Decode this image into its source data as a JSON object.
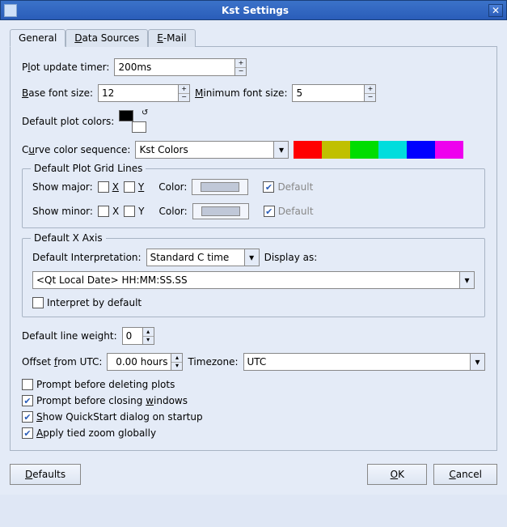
{
  "window": {
    "title": "Kst Settings"
  },
  "tabs": {
    "general": "General",
    "datasources": "Data Sources",
    "email": "E-Mail"
  },
  "plot_update": {
    "label_pre": "P",
    "label_u": "l",
    "label_post": "ot update timer:",
    "value": "200ms"
  },
  "base_font": {
    "label_u": "B",
    "label_post": "ase font size:",
    "value": "12"
  },
  "min_font": {
    "label_u": "M",
    "label_post": "inimum font size:",
    "value": "5"
  },
  "default_colors_label": "Default plot colors:",
  "curve_seq": {
    "label_pre": "C",
    "label_u": "u",
    "label_post": "rve color sequence:",
    "value": "Kst Colors"
  },
  "colors": [
    "#ff0000",
    "#c0c000",
    "#00dd00",
    "#00dddd",
    "#0000ff",
    "#ee00ee"
  ],
  "grid": {
    "legend": "Default Plot Grid Lines",
    "show_major": "Show major:",
    "show_minor": "Show minor:",
    "x": "X",
    "y": "Y",
    "color": "Color:",
    "default": "Default"
  },
  "xaxis": {
    "legend": "Default X Axis",
    "interp_label": "Default Interpretation:",
    "interp_value": "Standard C time",
    "display_label": "Display as:",
    "display_value": "<Qt Local Date> HH:MM:SS.SS",
    "interpret_by_default": "Interpret by default"
  },
  "line_weight": {
    "label": "Default line weight:",
    "value": "0"
  },
  "offset": {
    "label_pre": "Offset ",
    "label_u": "f",
    "label_post": "rom UTC:",
    "value": "0.00 hours"
  },
  "timezone": {
    "label": "Timezone:",
    "value": "UTC"
  },
  "checks": {
    "prompt_plots": "Prompt before deleting plots",
    "prompt_windows_pre": "Prompt before closing ",
    "prompt_windows_u": "w",
    "prompt_windows_post": "indows",
    "quickstart_u": "S",
    "quickstart_post": "how QuickStart dialog on startup",
    "tied_u": "A",
    "tied_post": "pply tied zoom globally"
  },
  "buttons": {
    "defaults_u": "D",
    "defaults_post": "efaults",
    "ok_u": "O",
    "ok_post": "K",
    "cancel_u": "C",
    "cancel_post": "ancel"
  }
}
